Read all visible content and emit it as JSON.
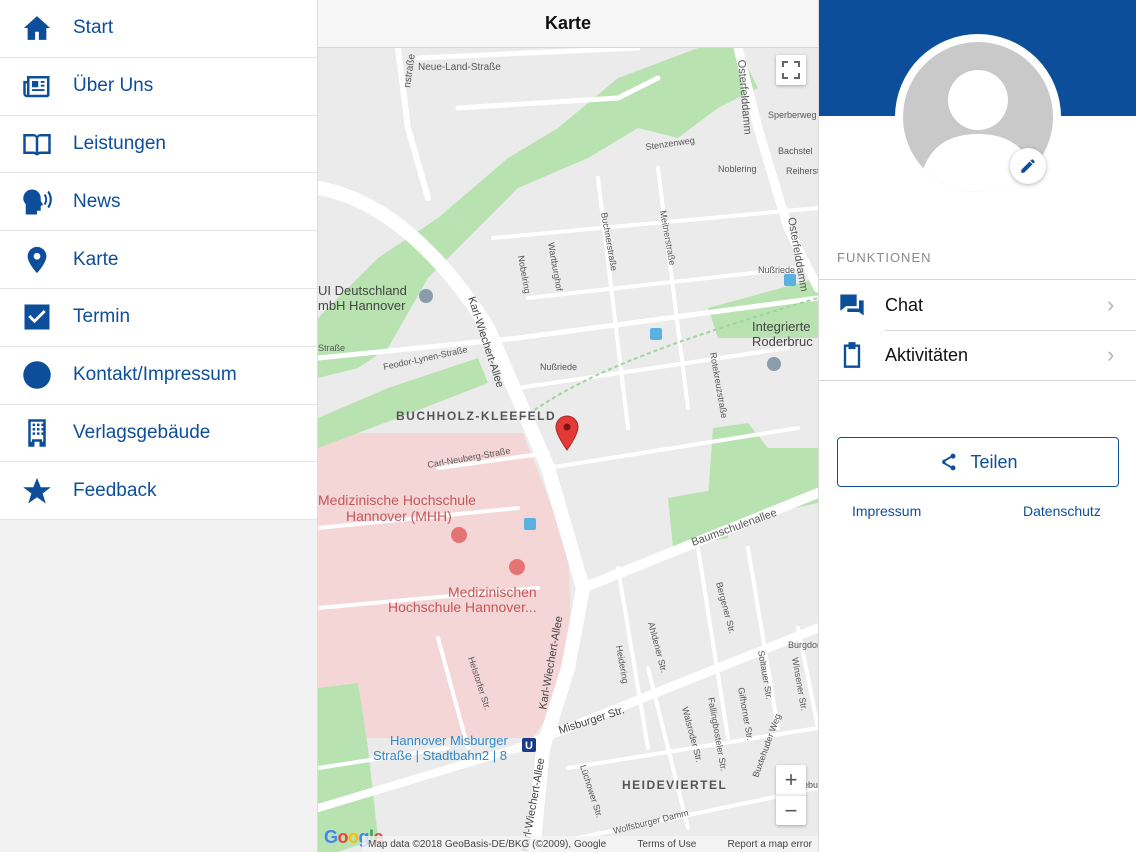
{
  "nav": {
    "items": [
      {
        "label": "Start",
        "icon": "home-icon"
      },
      {
        "label": "Über Uns",
        "icon": "newspaper-icon"
      },
      {
        "label": "Leistungen",
        "icon": "book-icon"
      },
      {
        "label": "News",
        "icon": "speaking-head-icon"
      },
      {
        "label": "Karte",
        "icon": "map-pin-icon"
      },
      {
        "label": "Termin",
        "icon": "checkbox-icon"
      },
      {
        "label": "Kontakt/Impressum",
        "icon": "at-sign-icon"
      },
      {
        "label": "Verlagsgebäude",
        "icon": "building-icon"
      },
      {
        "label": "Feedback",
        "icon": "star-icon"
      }
    ]
  },
  "map": {
    "title": "Karte",
    "labels": {
      "neue_land": "Neue-Land-Straße",
      "strasse_top": "nstraße",
      "osterfelddamm": "Osterfelddamm",
      "sperberweg": "Sperberweg",
      "bachstelzen": "Bachstel",
      "reiherstieg": "Reiherst",
      "noblering": "Noblering",
      "nussriede1": "Nußriede",
      "nussriede2": "Nußriede",
      "wartburg": "Wartburghof",
      "buchnerstr": "Buchnerstraße",
      "meitnerstr": "Meitnerstraße",
      "nobelring": "Nobelring",
      "stenzenweg": "Stenzenweg",
      "tui": "UI Deutschland",
      "tui2": "mbH Hannover",
      "integrierte": "Integrierte",
      "roderbruch": "Roderbruc",
      "strasse_left": "Straße",
      "feodor": "Feodor-Lynen-Straße",
      "karl1": "Karl-Wiechert-Allee",
      "karl2": "Karl-Wiechert-Allee",
      "karl3": "Karl-Wiechert-Allee",
      "rotekreuz": "Rotekreuzstraße",
      "buchholz": "BUCHHOLZ-KLEEFELD",
      "carl": "Carl-Neuberg-Straße",
      "mhh1": "Medizinische Hochschule",
      "mhh2": "Hannover (MHH)",
      "mhh3": "Medizinischen",
      "mhh4": "Hochschule Hannover...",
      "baumschulen": "Baumschulenallee",
      "bergener": "Bergener Str.",
      "ahldener": "Ahldener Str.",
      "heidering": "Heidering",
      "soltauer": "Soltauer Str.",
      "burgdorfer": "Burgdorfer",
      "winsener": "Winsener Str.",
      "helstorfer": "Helstorfer Str.",
      "misburger": "Misburger Str.",
      "fallingbosteler": "Fallingbosteler Str.",
      "gifhorner": "Gifhorner Str.",
      "walsroder": "Walsroder Str.",
      "station1": "Hannover Misburger",
      "station2": "Straße | Stadtbahn2 | 8",
      "luneburger": "Lünebu",
      "luchower": "Lüchower Str.",
      "wolfsburger": "Wolfsburger Damm",
      "buxtehuder": "Buxtehuder Weg",
      "heideviertel": "HEIDEVIERTEL",
      "stenzel": "Stenzelweg"
    },
    "attribution": {
      "data": "Map data ©2018 GeoBasis-DE/BKG (©2009), Google",
      "terms": "Terms of Use",
      "report": "Report a map error"
    },
    "google": [
      "G",
      "o",
      "o",
      "g",
      "l",
      "e"
    ],
    "zoom_in": "+",
    "zoom_out": "−"
  },
  "panel": {
    "section_title": "FUNKTIONEN",
    "functions": [
      {
        "label": "Chat",
        "icon": "chat-icon"
      },
      {
        "label": "Aktivitäten",
        "icon": "clipboard-icon"
      }
    ],
    "share_label": "Teilen",
    "impressum": "Impressum",
    "datenschutz": "Datenschutz"
  },
  "colors": {
    "brand": "#0d4e9a",
    "park": "#b8e3b0",
    "hospital": "#f5d6d6"
  }
}
